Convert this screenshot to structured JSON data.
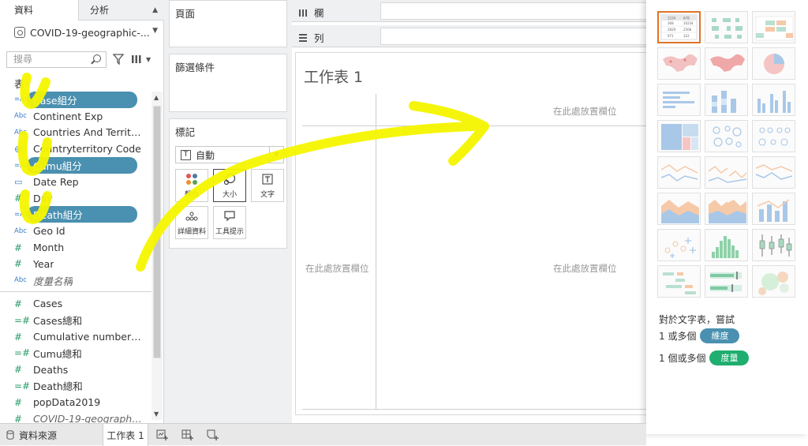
{
  "left_pane": {
    "tabs": {
      "data": "資料",
      "analysis": "分析"
    },
    "datasource": "COVID-19-geographic-...",
    "search_placeholder": "搜尋",
    "section_label": "表",
    "dimension_fields": [
      {
        "icon": "abc-calc-icon",
        "name": "Case組分",
        "selected": true
      },
      {
        "icon": "abc-icon",
        "name": "Continent Exp"
      },
      {
        "icon": "abc-icon",
        "name": "Countries And Territor..."
      },
      {
        "icon": "globe-icon",
        "name": "Countryterritory Code"
      },
      {
        "icon": "abc-calc-icon",
        "name": "Cumu組分",
        "selected": true
      },
      {
        "icon": "calendar-icon",
        "name": "Date Rep"
      },
      {
        "icon": "number-icon",
        "name": "Day"
      },
      {
        "icon": "abc-calc-icon",
        "name": "Death組分",
        "selected": true
      },
      {
        "icon": "abc-icon",
        "name": "Geo Id"
      },
      {
        "icon": "number-icon",
        "name": "Month"
      },
      {
        "icon": "number-icon",
        "name": "Year"
      },
      {
        "icon": "abc-icon",
        "name": "度量名稱",
        "italic": true
      }
    ],
    "measure_fields": [
      {
        "icon": "number-icon",
        "name": "Cases"
      },
      {
        "icon": "number-calc-icon",
        "name": "Cases總和"
      },
      {
        "icon": "number-icon",
        "name": "Cumulative number fo..."
      },
      {
        "icon": "number-calc-icon",
        "name": "Cumu總和"
      },
      {
        "icon": "number-icon",
        "name": "Deaths"
      },
      {
        "icon": "number-calc-icon",
        "name": "Death總和"
      },
      {
        "icon": "number-icon",
        "name": "popData2019"
      },
      {
        "icon": "number-icon",
        "name": "COVID-19-geographic-...",
        "italic": true
      }
    ]
  },
  "shelves": {
    "pages": "頁面",
    "filters": "篩選條件",
    "marks": "標記",
    "mark_type": "自動",
    "mark_buttons": [
      {
        "label": "顏色"
      },
      {
        "label": "大小"
      },
      {
        "label": "文字"
      },
      {
        "label": "詳細資料"
      },
      {
        "label": "工具提示"
      }
    ],
    "columns": "欄",
    "rows": "列"
  },
  "canvas": {
    "title": "工作表 1",
    "drop_column": "在此處放置欄位",
    "drop_row": "在此處放置欄位",
    "drop_cell": "在此處放置欄位"
  },
  "show_me": {
    "hint": "對於文字表，嘗試",
    "req1_prefix": "1 或多個",
    "req1_pill": "維度",
    "req2_prefix": "1 個或多個",
    "req2_pill": "度量",
    "thumb_text": [
      "1234",
      "678",
      "368",
      "10234",
      "2829",
      "2568",
      "971",
      "322"
    ]
  },
  "bottom": {
    "datasource_tab": "資料來源",
    "sheet_tab": "工作表 1"
  },
  "colors": {
    "selected_field": "#4a90b0",
    "dimension_pill": "#4a90b0",
    "measure_pill": "#1fae6f",
    "highlight_border": "#e0742a",
    "annotation": "#f5f500"
  }
}
